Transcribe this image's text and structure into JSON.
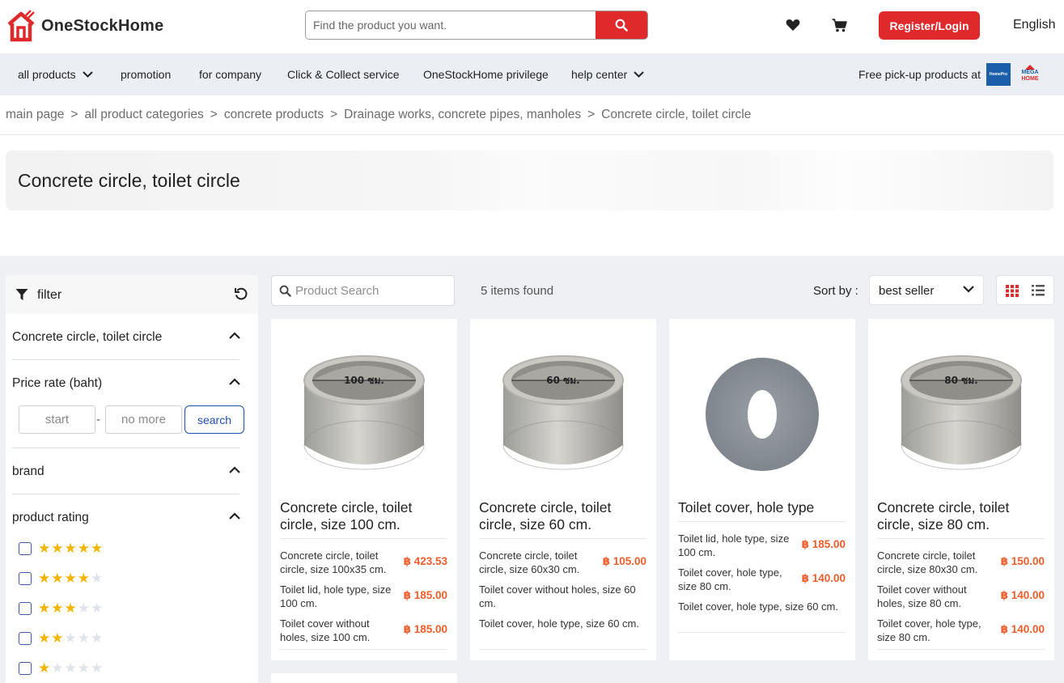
{
  "header": {
    "brand": "OneStockHome",
    "search_placeholder": "Find the product you want.",
    "login_label": "Register/Login",
    "language": "English"
  },
  "nav": {
    "items": [
      {
        "label": "all products",
        "has_dropdown": true
      },
      {
        "label": "promotion",
        "has_dropdown": false
      },
      {
        "label": "for company",
        "has_dropdown": false
      },
      {
        "label": "Click & Collect service",
        "has_dropdown": false
      },
      {
        "label": "OneStockHome privilege",
        "has_dropdown": false
      },
      {
        "label": "help center",
        "has_dropdown": true
      }
    ],
    "pickup_label": "Free pick-up products at",
    "store_logo_1": "HomePro",
    "store_logo_2_top": "MEGA",
    "store_logo_2_bottom": "HOME"
  },
  "breadcrumb": [
    "main page",
    "all product categories",
    "concrete products",
    "Drainage works, concrete pipes, manholes",
    "Concrete circle, toilet circle"
  ],
  "page_title": "Concrete circle, toilet circle",
  "filter": {
    "title": "filter",
    "category_section": "Concrete circle, toilet circle",
    "price_section": "Price rate (baht)",
    "price_start_placeholder": "start",
    "price_end_placeholder": "no more",
    "price_search_label": "search",
    "brand_section": "brand",
    "rating_section": "product rating",
    "rating_levels": [
      5,
      4,
      3,
      2,
      1
    ]
  },
  "toolbar": {
    "product_search_placeholder": "Product Search",
    "items_found": "5 items found",
    "sort_label": "Sort by :",
    "sort_value": "best seller"
  },
  "products": [
    {
      "name": "Concrete circle, toilet circle, size 100 cm.",
      "image_label": "100 ซม.",
      "variants": [
        {
          "name": "Concrete circle, toilet circle, size 100x35 cm.",
          "price": "฿ 423.53"
        },
        {
          "name": "Toilet lid, hole type, size 100 cm.",
          "price": "฿ 185.00"
        },
        {
          "name": "Toilet cover without holes, size 100 cm.",
          "price": "฿ 185.00"
        }
      ]
    },
    {
      "name": "Concrete circle, toilet circle, size 60 cm.",
      "image_label": "60 ซม.",
      "variants": [
        {
          "name": "Concrete circle, toilet circle, size 60x30 cm.",
          "price": "฿ 105.00"
        },
        {
          "name": "Toilet cover without holes, size 60 cm.",
          "price": ""
        },
        {
          "name": "Toilet cover, hole type, size 60 cm.",
          "price": ""
        }
      ]
    },
    {
      "name": "Toilet cover, hole type",
      "image_label": "",
      "variants": [
        {
          "name": "Toilet lid, hole type, size 100 cm.",
          "price": "฿ 185.00"
        },
        {
          "name": "Toilet cover, hole type, size 80 cm.",
          "price": "฿ 140.00"
        },
        {
          "name": "Toilet cover, hole type, size 60 cm.",
          "price": ""
        }
      ]
    },
    {
      "name": "Concrete circle, toilet circle, size 80 cm.",
      "image_label": "80 ซม.",
      "variants": [
        {
          "name": "Concrete circle, toilet circle, size 80x30 cm.",
          "price": "฿ 150.00"
        },
        {
          "name": "Toilet cover without holes, size 80 cm.",
          "price": "฿ 140.00"
        },
        {
          "name": "Toilet cover, hole type, size 80 cm.",
          "price": "฿ 140.00"
        }
      ]
    }
  ],
  "colors": {
    "accent_red": "#e0292b",
    "price_orange": "#ee5d2b",
    "star_gold": "#f4b400",
    "link_blue": "#1f4db0"
  }
}
